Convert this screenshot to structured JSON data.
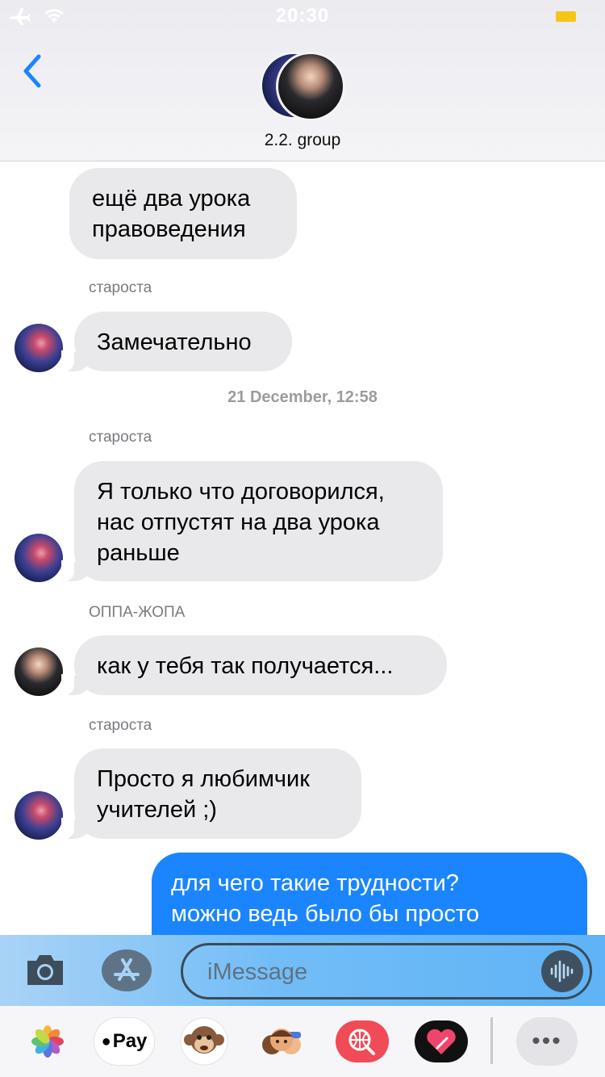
{
  "status_bar": {
    "time": "20:30",
    "icons": [
      "airplane-icon",
      "wifi-icon",
      "battery-icon"
    ],
    "battery_color": "#f5c518"
  },
  "header": {
    "back_icon": "chevron-left-icon",
    "group_name": "2.2. group"
  },
  "messages": [
    {
      "type": "incoming",
      "text": "ещё два урока правоведения",
      "lines": [
        "ещё два урока",
        "правоведения"
      ]
    },
    {
      "type": "sender",
      "text": "староста"
    },
    {
      "type": "incoming",
      "text": "Замечательно",
      "avatar": "starosta"
    },
    {
      "type": "timestamp",
      "text": "21 December, 12:58"
    },
    {
      "type": "sender",
      "text": "староста"
    },
    {
      "type": "incoming",
      "lines": [
        "Я только что договорился,",
        "нас отпустят на два урока",
        "раньше"
      ],
      "avatar": "starosta"
    },
    {
      "type": "sender",
      "text": "ОППА-ЖОПА"
    },
    {
      "type": "incoming",
      "text": "как у тебя так получается...",
      "avatar": "oppa"
    },
    {
      "type": "sender",
      "text": "староста"
    },
    {
      "type": "incoming",
      "lines": [
        "Просто я любимчик",
        "учителей ;)"
      ],
      "avatar": "starosta"
    },
    {
      "type": "outgoing",
      "lines": [
        "для чего такие трудности?",
        "можно ведь было бы просто"
      ]
    }
  ],
  "compose": {
    "placeholder": "iMessage",
    "icons": [
      "camera-icon",
      "app-store-icon",
      "audio-waveform-icon"
    ]
  },
  "drawer": {
    "items": [
      "photos-icon",
      "apple-pay-icon",
      "animoji-monkey-icon",
      "memoji-icon",
      "web-search-icon",
      "digital-touch-icon",
      "more-icon"
    ],
    "apple_pay_label": "Pay",
    "more_label": "•••"
  },
  "colors": {
    "incoming_bubble": "#e9e9eb",
    "outgoing_bubble": "#1a85ff",
    "accent": "#1a85ff"
  }
}
